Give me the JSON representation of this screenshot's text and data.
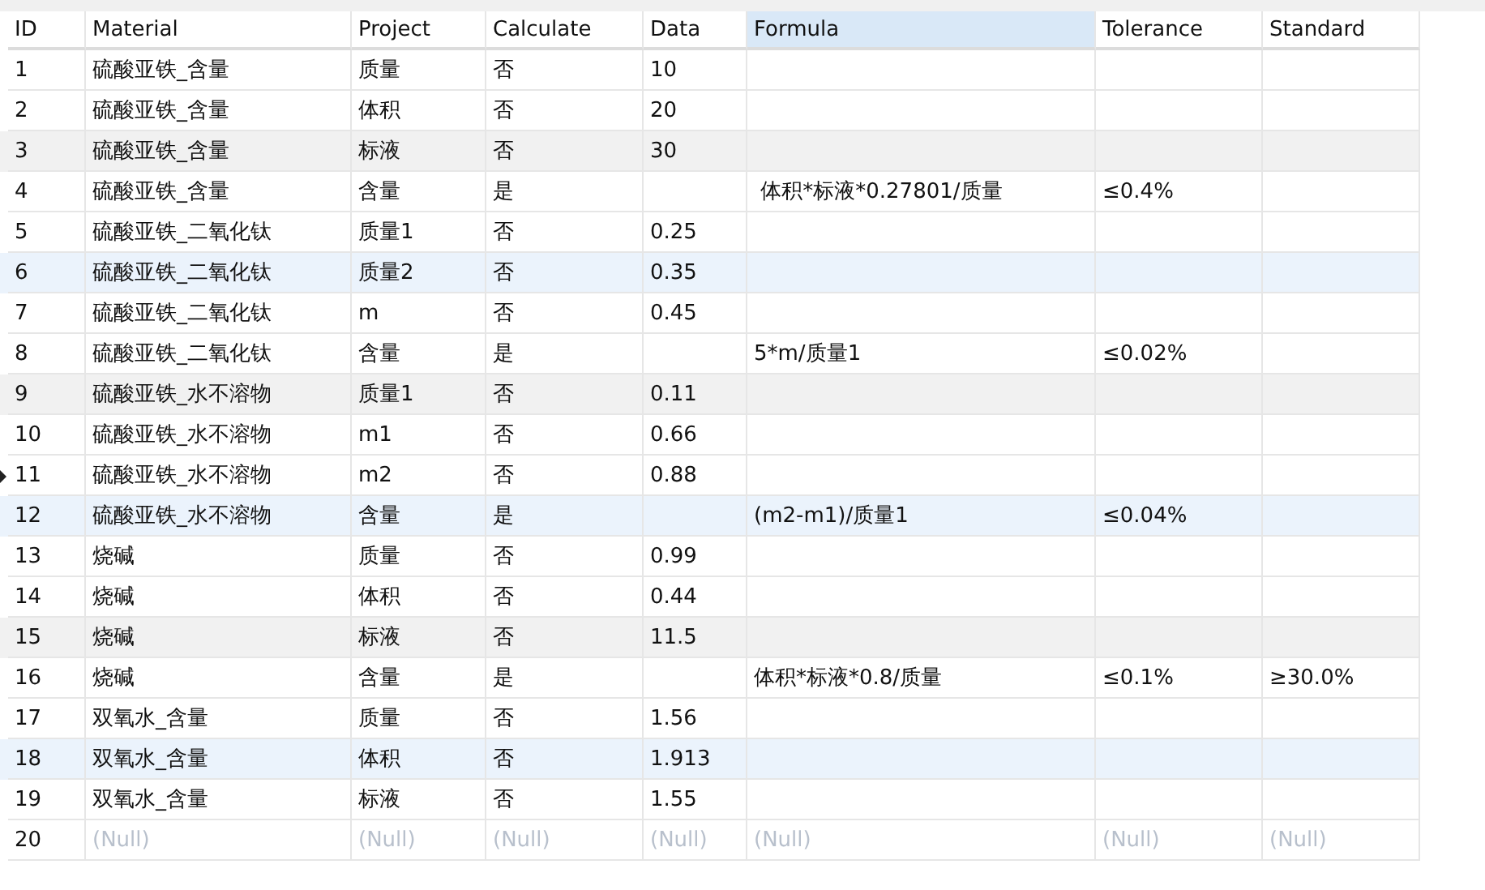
{
  "columns": [
    {
      "label": "ID",
      "selected": false
    },
    {
      "label": "Material",
      "selected": false
    },
    {
      "label": "Project",
      "selected": false
    },
    {
      "label": "Calculate",
      "selected": false
    },
    {
      "label": "Data",
      "selected": false
    },
    {
      "label": "Formula",
      "selected": true
    },
    {
      "label": "Tolerance",
      "selected": false
    },
    {
      "label": "Standard",
      "selected": false
    }
  ],
  "rows": [
    {
      "cells": [
        "1",
        "硫酸亚铁_含量",
        "质量",
        "否",
        "10",
        "",
        "",
        ""
      ],
      "current": false,
      "shaded": false,
      "highlighted": false,
      "null_row": false
    },
    {
      "cells": [
        "2",
        "硫酸亚铁_含量",
        "体积",
        "否",
        "20",
        "",
        "",
        ""
      ],
      "current": false,
      "shaded": false,
      "highlighted": false,
      "null_row": false
    },
    {
      "cells": [
        "3",
        "硫酸亚铁_含量",
        "标液",
        "否",
        "30",
        "",
        "",
        ""
      ],
      "current": false,
      "shaded": true,
      "highlighted": false,
      "null_row": false
    },
    {
      "cells": [
        "4",
        "硫酸亚铁_含量",
        "含量",
        "是",
        "",
        " 体积*标液*0.27801/质量",
        "≤0.4%",
        ""
      ],
      "current": false,
      "shaded": false,
      "highlighted": false,
      "null_row": false
    },
    {
      "cells": [
        "5",
        "硫酸亚铁_二氧化钛",
        "质量1",
        "否",
        "0.25",
        "",
        "",
        ""
      ],
      "current": false,
      "shaded": false,
      "highlighted": false,
      "null_row": false
    },
    {
      "cells": [
        "6",
        "硫酸亚铁_二氧化钛",
        "质量2",
        "否",
        "0.35",
        "",
        "",
        ""
      ],
      "current": false,
      "shaded": false,
      "highlighted": true,
      "null_row": false
    },
    {
      "cells": [
        "7",
        "硫酸亚铁_二氧化钛",
        "m",
        "否",
        "0.45",
        "",
        "",
        ""
      ],
      "current": false,
      "shaded": false,
      "highlighted": false,
      "null_row": false
    },
    {
      "cells": [
        "8",
        "硫酸亚铁_二氧化钛",
        "含量",
        "是",
        "",
        "5*m/质量1",
        "≤0.02%",
        ""
      ],
      "current": false,
      "shaded": false,
      "highlighted": false,
      "null_row": false
    },
    {
      "cells": [
        "9",
        "硫酸亚铁_水不溶物",
        "质量1",
        "否",
        "0.11",
        "",
        "",
        ""
      ],
      "current": false,
      "shaded": true,
      "highlighted": false,
      "null_row": false
    },
    {
      "cells": [
        "10",
        "硫酸亚铁_水不溶物",
        "m1",
        "否",
        "0.66",
        "",
        "",
        ""
      ],
      "current": false,
      "shaded": false,
      "highlighted": false,
      "null_row": false
    },
    {
      "cells": [
        "11",
        "硫酸亚铁_水不溶物",
        "m2",
        "否",
        "0.88",
        "",
        "",
        ""
      ],
      "current": true,
      "shaded": false,
      "highlighted": false,
      "null_row": false
    },
    {
      "cells": [
        "12",
        "硫酸亚铁_水不溶物",
        "含量",
        "是",
        "",
        "(m2-m1)/质量1",
        "≤0.04%",
        ""
      ],
      "current": false,
      "shaded": false,
      "highlighted": true,
      "null_row": false
    },
    {
      "cells": [
        "13",
        "烧碱",
        "质量",
        "否",
        "0.99",
        "",
        "",
        ""
      ],
      "current": false,
      "shaded": false,
      "highlighted": false,
      "null_row": false
    },
    {
      "cells": [
        "14",
        "烧碱",
        "体积",
        "否",
        "0.44",
        "",
        "",
        ""
      ],
      "current": false,
      "shaded": false,
      "highlighted": false,
      "null_row": false
    },
    {
      "cells": [
        "15",
        "烧碱",
        "标液",
        "否",
        "11.5",
        "",
        "",
        ""
      ],
      "current": false,
      "shaded": true,
      "highlighted": false,
      "null_row": false
    },
    {
      "cells": [
        "16",
        "烧碱",
        "含量",
        "是",
        "",
        "体积*标液*0.8/质量",
        "≤0.1%",
        "≥30.0%"
      ],
      "current": false,
      "shaded": false,
      "highlighted": false,
      "null_row": false
    },
    {
      "cells": [
        "17",
        "双氧水_含量",
        "质量",
        "否",
        "1.56",
        "",
        "",
        ""
      ],
      "current": false,
      "shaded": false,
      "highlighted": false,
      "null_row": false
    },
    {
      "cells": [
        "18",
        "双氧水_含量",
        "体积",
        "否",
        "1.913",
        "",
        "",
        ""
      ],
      "current": false,
      "shaded": false,
      "highlighted": true,
      "null_row": false
    },
    {
      "cells": [
        "19",
        "双氧水_含量",
        "标液",
        "否",
        "1.55",
        "",
        "",
        ""
      ],
      "current": false,
      "shaded": false,
      "highlighted": false,
      "null_row": false
    },
    {
      "cells": [
        "20",
        "(Null)",
        "(Null)",
        "(Null)",
        "(Null)",
        "(Null)",
        "(Null)",
        "(Null)"
      ],
      "current": false,
      "shaded": false,
      "highlighted": false,
      "null_row": true
    }
  ]
}
